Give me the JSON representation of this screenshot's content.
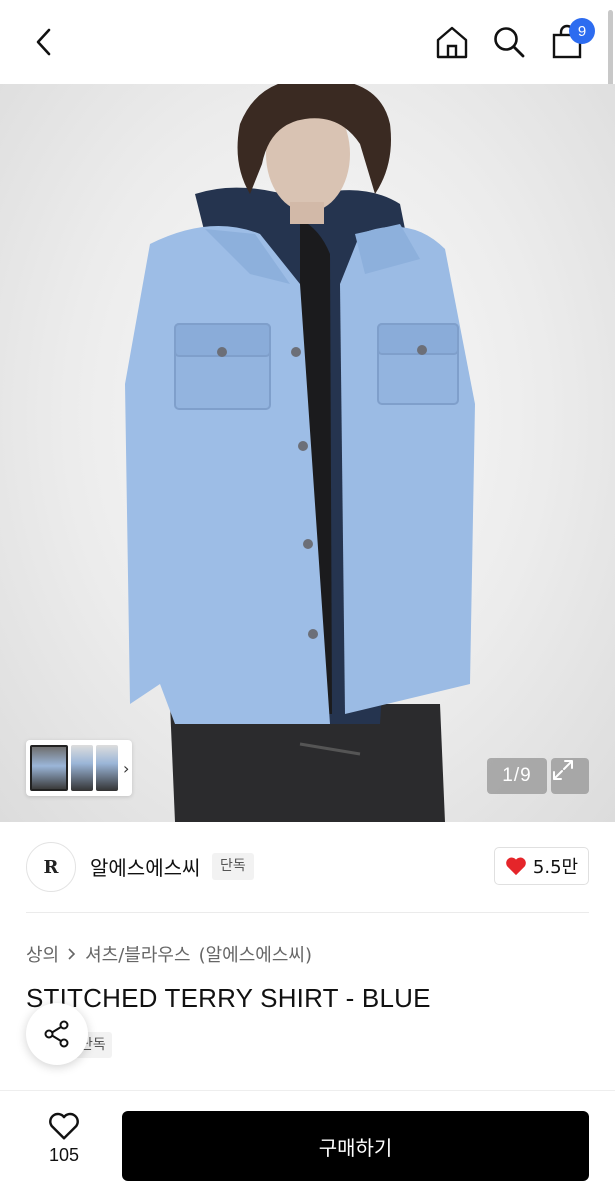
{
  "header": {
    "back_icon": "chevron-left-icon",
    "home_icon": "home-icon",
    "search_icon": "search-icon",
    "cart_icon": "shopping-bag-icon",
    "cart_badge_count": "9",
    "badge_color": "#2d6cf0"
  },
  "gallery": {
    "image_description_icon": "product-photo",
    "page_counter": "1/9",
    "expand_icon": "expand-icon",
    "thumbnail_chevron": "›"
  },
  "brand": {
    "logo_text": "R",
    "name": "알에스에스씨",
    "tag": "단독",
    "like_icon": "heart-filled-icon",
    "like_count": "5.5만",
    "heart_color": "#e5252a"
  },
  "product": {
    "breadcrumb": [
      "상의",
      "셔츠/블라우스",
      "(알에스에스씨)"
    ],
    "title": "STITCHED TERRY SHIRT - BLUE",
    "tag": "단독"
  },
  "bottom_bar": {
    "wish_icon": "heart-outline-icon",
    "wish_count": "105",
    "buy_label": "구매하기"
  }
}
